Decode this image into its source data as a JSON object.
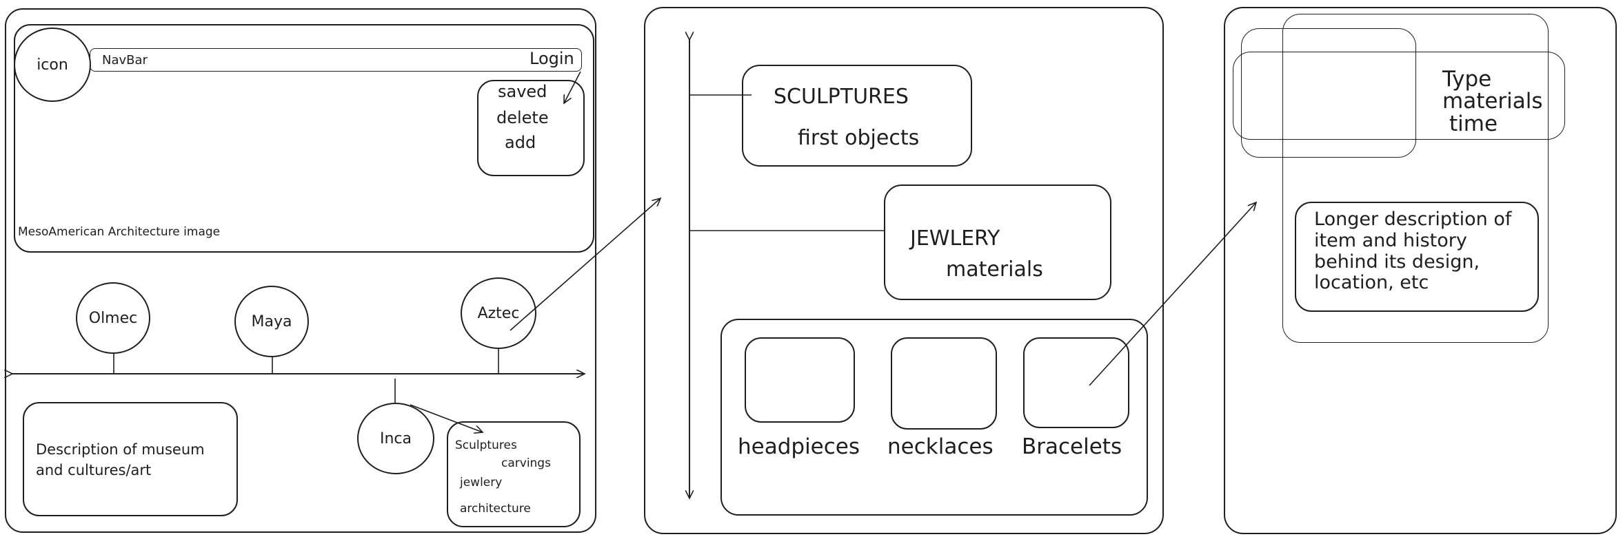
{
  "frames": {
    "home": {
      "hero": {
        "icon_label": "icon",
        "navbar_label": "NavBar",
        "login_label": "Login",
        "login_menu": [
          "saved",
          "delete",
          "add"
        ],
        "image_caption": "MesoAmerican Architecture image"
      },
      "timeline": {
        "above": [
          "Olmec",
          "Maya",
          "Aztec"
        ],
        "below": [
          "Inca"
        ]
      },
      "description": "Description of museum and cultures/art",
      "culture_menu": [
        "Sculptures",
        "carvings",
        "jewlery",
        "architecture"
      ]
    },
    "culture": {
      "sections": [
        {
          "title": "SCULPTURES",
          "subtitle": "first objects"
        },
        {
          "title": "JEWLERY",
          "subtitle": "materials"
        }
      ],
      "categories": [
        "headpieces",
        "necklaces",
        "Bracelets"
      ]
    },
    "item": {
      "details": [
        "Type",
        "materials",
        "time"
      ],
      "long_description": "Longer description of item and history behind its design, location, etc"
    }
  }
}
